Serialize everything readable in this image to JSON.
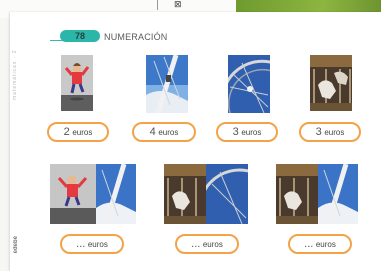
{
  "header": {
    "badge": "78",
    "title": "NUMERACIÓN"
  },
  "side_text": "matemáticas · 2",
  "side_logo": "edebé",
  "top_mark": "⊠",
  "row1": [
    {
      "picture": "girl-jumping-photo",
      "num": "2",
      "unit": "euros"
    },
    {
      "picture": "swing-ride-photo",
      "num": "4",
      "unit": "euros"
    },
    {
      "picture": "ferris-wheel-photo",
      "num": "3",
      "unit": "euros"
    },
    {
      "picture": "carousel-horses-photo",
      "num": "3",
      "unit": "euros"
    }
  ],
  "row2": [
    {
      "pictures": [
        "girl-jumping-photo",
        "swing-ride-photo"
      ],
      "num": "...",
      "unit": "euros"
    },
    {
      "pictures": [
        "carousel-horses-photo",
        "ferris-wheel-photo"
      ],
      "num": "...",
      "unit": "euros"
    },
    {
      "pictures": [
        "carousel-horses-photo",
        "swing-ride-photo"
      ],
      "num": "...",
      "unit": "euros"
    }
  ],
  "colors": {
    "accent_teal": "#2cb6a9",
    "pill_border": "#f3a24a",
    "green_strip": "#8cb640"
  }
}
